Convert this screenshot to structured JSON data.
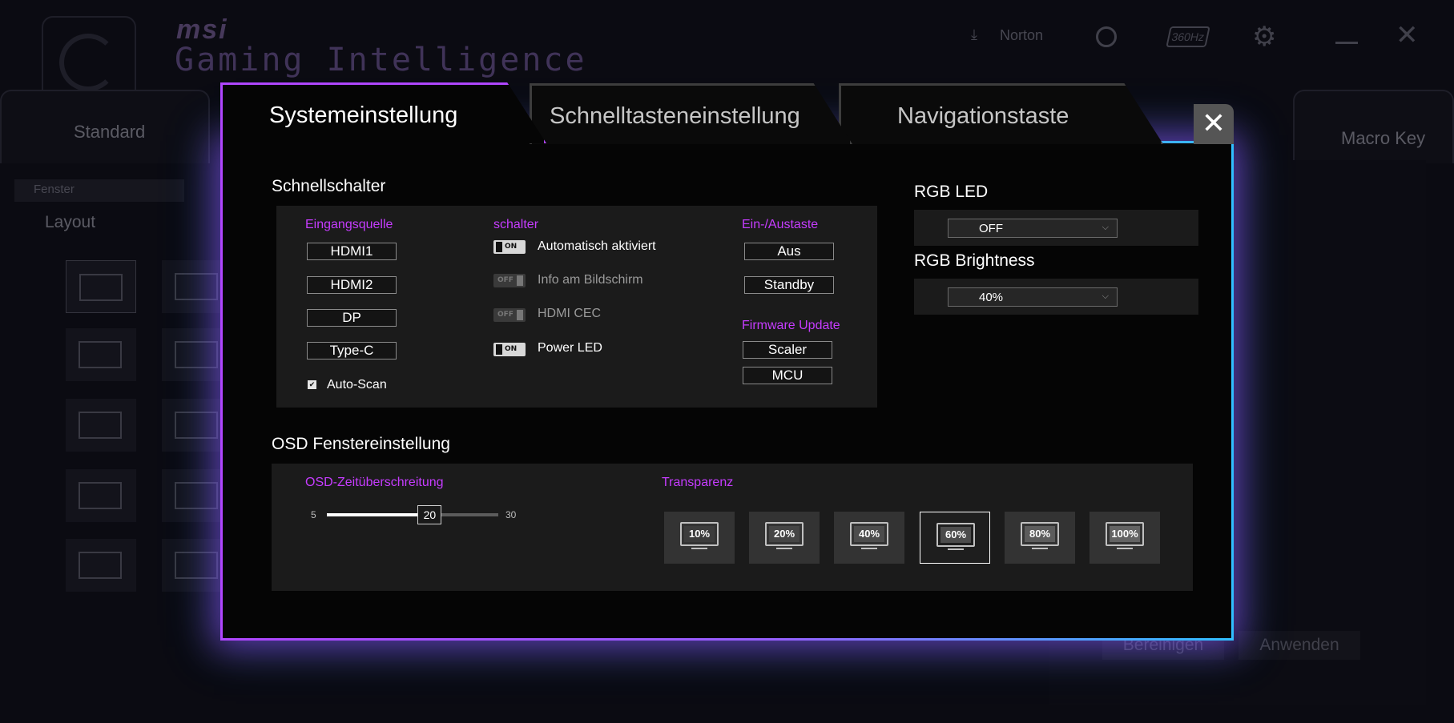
{
  "background": {
    "brand": "msi",
    "app_title": "Gaming Intelligence",
    "norton_label": "Norton",
    "hz_label": "360Hz",
    "tabs": [
      "Standard",
      "Macro Key"
    ],
    "window_select": "Fenster",
    "layout_label": "Layout",
    "bottom_buttons": [
      "Bereinigen",
      "Anwenden"
    ]
  },
  "dialog": {
    "tabs": [
      "Systemeinstellung",
      "Schnelltasteneinstellung",
      "Navigationstaste"
    ],
    "active_tab": "Systemeinstellung",
    "close_icon": "close-icon",
    "quick_switch": {
      "title": "Schnellschalter",
      "input_source": {
        "header": "Eingangsquelle",
        "buttons": [
          "HDMI1",
          "HDMI2",
          "DP",
          "Type-C"
        ],
        "auto_scan": {
          "label": "Auto-Scan",
          "checked": true
        }
      },
      "switches": {
        "header": "schalter",
        "items": [
          {
            "label": "Automatisch aktiviert",
            "state": "ON"
          },
          {
            "label": "Info am Bildschirm",
            "state": "OFF"
          },
          {
            "label": "HDMI CEC",
            "state": "OFF"
          },
          {
            "label": "Power LED",
            "state": "ON"
          }
        ]
      },
      "power_key": {
        "header": "Ein-/Austaste",
        "buttons": [
          "Aus",
          "Standby"
        ]
      },
      "firmware": {
        "header": "Firmware Update",
        "buttons": [
          "Scaler",
          "MCU"
        ]
      }
    },
    "rgb": {
      "led_title": "RGB LED",
      "led_value": "OFF",
      "brightness_title": "RGB Brightness",
      "brightness_value": "40%"
    },
    "osd": {
      "title": "OSD Fenstereinstellung",
      "timeout": {
        "label": "OSD-Zeitüberschreitung",
        "min": "5",
        "max": "30",
        "value": "20",
        "min_num": 5,
        "max_num": 30,
        "value_num": 20
      },
      "transparency": {
        "label": "Transparenz",
        "options": [
          "10%",
          "20%",
          "40%",
          "60%",
          "80%",
          "100%"
        ],
        "selected": "60%"
      }
    }
  },
  "colors": {
    "accent_purple": "#c63cff",
    "glow_purple": "#b046ff",
    "glow_blue": "#30bfff"
  }
}
